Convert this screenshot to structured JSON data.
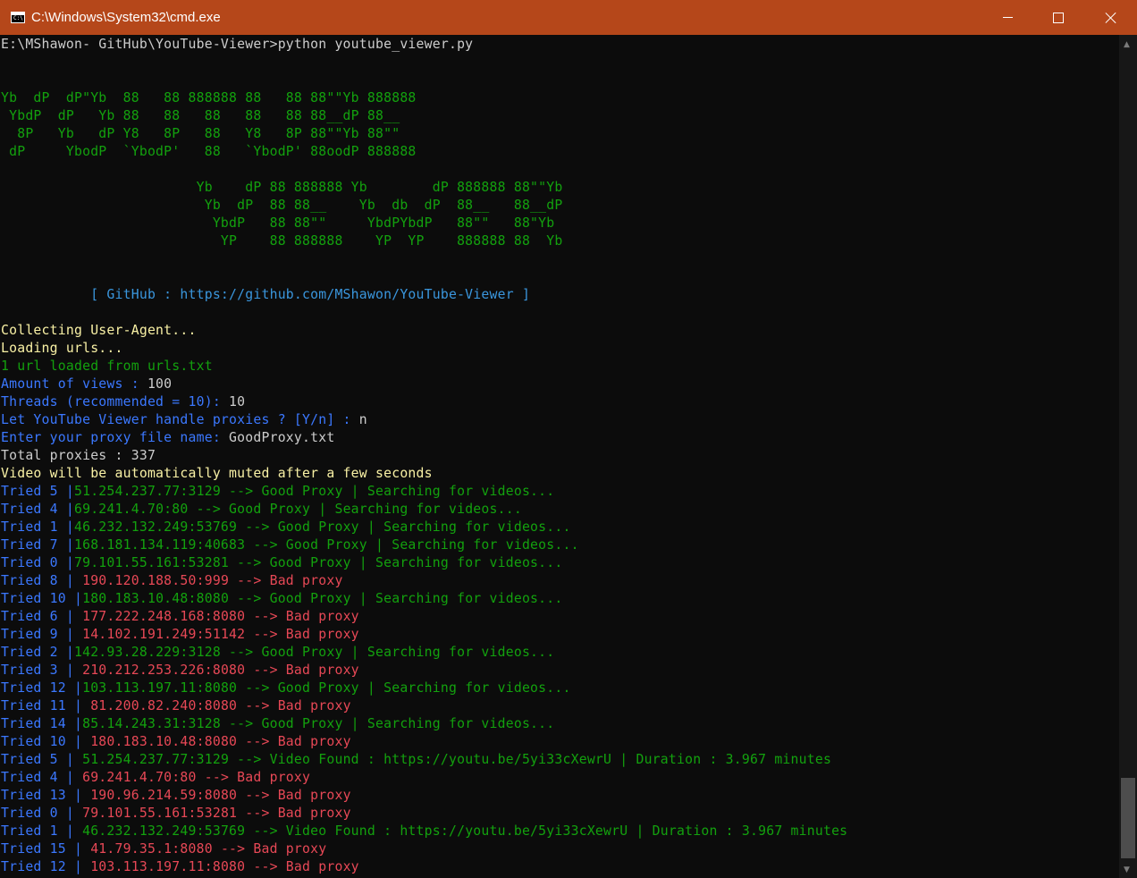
{
  "window": {
    "title": "C:\\Windows\\System32\\cmd.exe",
    "icon_text": "C:\\",
    "icon": "cmd-icon"
  },
  "controls": {
    "minimize": "minimize-icon",
    "maximize": "maximize-icon",
    "close": "close-icon"
  },
  "colors": {
    "titlebar": "#b5471a",
    "background": "#0c0c0c",
    "white": "#cccccc",
    "green": "#13a10e",
    "blue": "#3b78ff",
    "yellow": "#f9f1a5",
    "red": "#e74856",
    "cyan": "#3a96dd"
  },
  "lines": [
    [
      {
        "t": "E:\\MShawon- GitHub\\YouTube-Viewer>python youtube_viewer.py",
        "c": "white"
      }
    ],
    [],
    [],
    [
      {
        "t": "Yb  dP  dP\"Yb  88   88 888888 88   88 88\"\"Yb 888888",
        "c": "green"
      }
    ],
    [
      {
        "t": " YbdP  dP   Yb 88   88   88   88   88 88__dP 88__",
        "c": "green"
      }
    ],
    [
      {
        "t": "  8P   Yb   dP Y8   8P   88   Y8   8P 88\"\"Yb 88\"\"",
        "c": "green"
      }
    ],
    [
      {
        "t": " dP     YbodP  `YbodP'   88   `YbodP' 88oodP 888888",
        "c": "green"
      }
    ],
    [],
    [
      {
        "t": "                        Yb    dP 88 888888 Yb        dP 888888 88\"\"Yb",
        "c": "green"
      }
    ],
    [
      {
        "t": "                         Yb  dP  88 88__    Yb  db  dP  88__   88__dP",
        "c": "green"
      }
    ],
    [
      {
        "t": "                          YbdP   88 88\"\"     YbdPYbdP   88\"\"   88\"Yb",
        "c": "green"
      }
    ],
    [
      {
        "t": "                           YP    88 888888    YP  YP    888888 88  Yb",
        "c": "green"
      }
    ],
    [],
    [],
    [
      {
        "t": "           [ GitHub : https://github.com/MShawon/YouTube-Viewer ]",
        "c": "cyan"
      }
    ],
    [],
    [
      {
        "t": "Collecting User-Agent...",
        "c": "yellow"
      }
    ],
    [
      {
        "t": "Loading urls...",
        "c": "yellow"
      }
    ],
    [
      {
        "t": "1 url loaded from urls.txt",
        "c": "green"
      }
    ],
    [
      {
        "t": "Amount of views : ",
        "c": "blue"
      },
      {
        "t": "100",
        "c": "white"
      }
    ],
    [
      {
        "t": "Threads (recommended = 10): ",
        "c": "blue"
      },
      {
        "t": "10",
        "c": "white"
      }
    ],
    [
      {
        "t": "Let YouTube Viewer handle proxies ? [Y/n] : ",
        "c": "blue"
      },
      {
        "t": "n",
        "c": "white"
      }
    ],
    [
      {
        "t": "Enter your proxy file name: ",
        "c": "blue"
      },
      {
        "t": "GoodProxy.txt",
        "c": "white"
      }
    ],
    [
      {
        "t": "Total proxies : 337",
        "c": "white"
      }
    ],
    [
      {
        "t": "Video will be automatically muted after a few seconds",
        "c": "yellow"
      }
    ],
    [
      {
        "t": "Tried 5 |",
        "c": "blue"
      },
      {
        "t": "51.254.237.77:3129 --> Good Proxy | Searching for videos...",
        "c": "green"
      }
    ],
    [
      {
        "t": "Tried 4 |",
        "c": "blue"
      },
      {
        "t": "69.241.4.70:80 --> Good Proxy | Searching for videos...",
        "c": "green"
      }
    ],
    [
      {
        "t": "Tried 1 |",
        "c": "blue"
      },
      {
        "t": "46.232.132.249:53769 --> Good Proxy | Searching for videos...",
        "c": "green"
      }
    ],
    [
      {
        "t": "Tried 7 |",
        "c": "blue"
      },
      {
        "t": "168.181.134.119:40683 --> Good Proxy | Searching for videos...",
        "c": "green"
      }
    ],
    [
      {
        "t": "Tried 0 |",
        "c": "blue"
      },
      {
        "t": "79.101.55.161:53281 --> Good Proxy | Searching for videos...",
        "c": "green"
      }
    ],
    [
      {
        "t": "Tried 8 | ",
        "c": "blue"
      },
      {
        "t": "190.120.188.50:999 --> Bad proxy",
        "c": "red"
      }
    ],
    [
      {
        "t": "Tried 10 |",
        "c": "blue"
      },
      {
        "t": "180.183.10.48:8080 --> Good Proxy | Searching for videos...",
        "c": "green"
      }
    ],
    [
      {
        "t": "Tried 6 | ",
        "c": "blue"
      },
      {
        "t": "177.222.248.168:8080 --> Bad proxy",
        "c": "red"
      }
    ],
    [
      {
        "t": "Tried 9 | ",
        "c": "blue"
      },
      {
        "t": "14.102.191.249:51142 --> Bad proxy",
        "c": "red"
      }
    ],
    [
      {
        "t": "Tried 2 |",
        "c": "blue"
      },
      {
        "t": "142.93.28.229:3128 --> Good Proxy | Searching for videos...",
        "c": "green"
      }
    ],
    [
      {
        "t": "Tried 3 | ",
        "c": "blue"
      },
      {
        "t": "210.212.253.226:8080 --> Bad proxy",
        "c": "red"
      }
    ],
    [
      {
        "t": "Tried 12 |",
        "c": "blue"
      },
      {
        "t": "103.113.197.11:8080 --> Good Proxy | Searching for videos...",
        "c": "green"
      }
    ],
    [
      {
        "t": "Tried 11 | ",
        "c": "blue"
      },
      {
        "t": "81.200.82.240:8080 --> Bad proxy",
        "c": "red"
      }
    ],
    [
      {
        "t": "Tried 14 |",
        "c": "blue"
      },
      {
        "t": "85.14.243.31:3128 --> Good Proxy | Searching for videos...",
        "c": "green"
      }
    ],
    [
      {
        "t": "Tried 10 | ",
        "c": "blue"
      },
      {
        "t": "180.183.10.48:8080 --> Bad proxy",
        "c": "red"
      }
    ],
    [
      {
        "t": "Tried 5 | ",
        "c": "blue"
      },
      {
        "t": "51.254.237.77:3129 --> Video Found : https://youtu.be/5yi33cXewrU | Duration : 3.967 minutes",
        "c": "green"
      }
    ],
    [
      {
        "t": "Tried 4 | ",
        "c": "blue"
      },
      {
        "t": "69.241.4.70:80 --> Bad proxy",
        "c": "red"
      }
    ],
    [
      {
        "t": "Tried 13 | ",
        "c": "blue"
      },
      {
        "t": "190.96.214.59:8080 --> Bad proxy",
        "c": "red"
      }
    ],
    [
      {
        "t": "Tried 0 | ",
        "c": "blue"
      },
      {
        "t": "79.101.55.161:53281 --> Bad proxy",
        "c": "red"
      }
    ],
    [
      {
        "t": "Tried 1 | ",
        "c": "blue"
      },
      {
        "t": "46.232.132.249:53769 --> Video Found : https://youtu.be/5yi33cXewrU | Duration : 3.967 minutes",
        "c": "green"
      }
    ],
    [
      {
        "t": "Tried 15 | ",
        "c": "blue"
      },
      {
        "t": "41.79.35.1:8080 --> Bad proxy",
        "c": "red"
      }
    ],
    [
      {
        "t": "Tried 12 | ",
        "c": "blue"
      },
      {
        "t": "103.113.197.11:8080 --> Bad proxy",
        "c": "red"
      }
    ]
  ]
}
